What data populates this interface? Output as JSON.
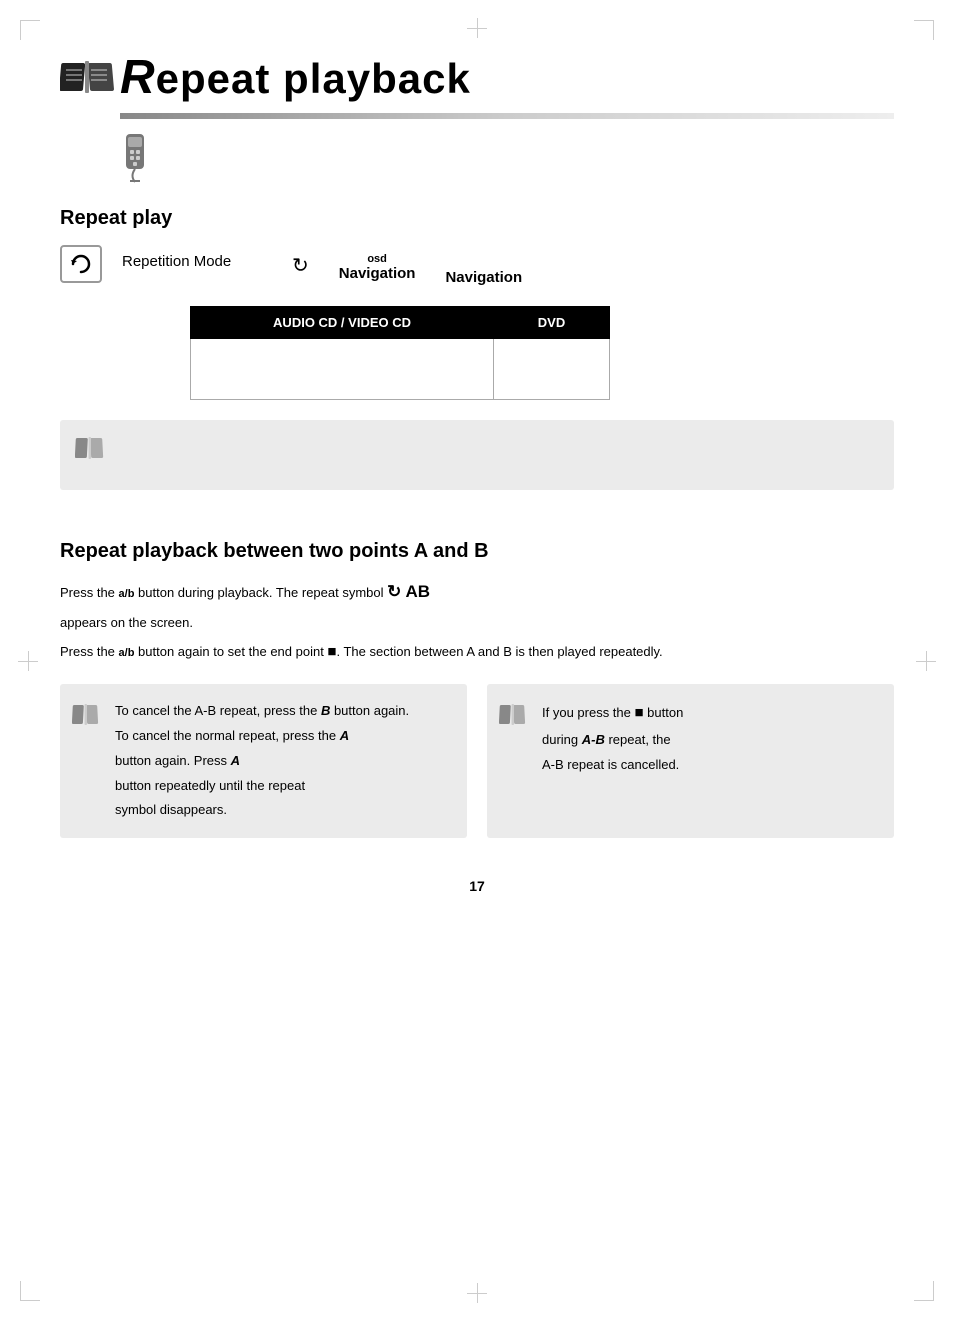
{
  "page": {
    "number": "17"
  },
  "title": {
    "main": "epeat playback",
    "R_prefix": "R"
  },
  "repeat_play": {
    "heading": "Repeat play",
    "button_symbol": "↻",
    "repetition_mode_label": "Repetition Mode",
    "repeat_symbol": "↻",
    "osd_label": "osd",
    "navigation_label": "Navigation",
    "navigation_label2": "Navigation",
    "table": {
      "col1_header": "AUDIO CD / VIDEO CD",
      "col2_header": "DVD",
      "col1_content": "",
      "col2_content": ""
    }
  },
  "ab_section": {
    "heading": "Repeat playback between two points A and B",
    "desc_line1_prefix": "Press the",
    "key_ab": "a/b",
    "desc_line1_suffix": "button during playback. The repeat symbol",
    "ab_symbol": "↻ AB",
    "desc_line2": "appears on the screen.",
    "desc_line3_prefix": "Press the",
    "key_ab2": "a/b",
    "desc_line3_middle": "button again to set the end point",
    "stop_symbol": "■",
    "desc_line3_suffix": ". The section between A and B is then played repeatedly.",
    "note_left": {
      "bold_B": "B",
      "text1_prefix": "To cancel the A-B repeat, press the",
      "bold_A1": "A",
      "text1_suffix": "button again.",
      "text2_prefix": "To cancel the normal repeat, press the",
      "bold_A2": "A",
      "text2_suffix": "button repeatedly until the repeat symbol disappears."
    },
    "note_right": {
      "stop_symbol": "■",
      "bold_AB": "A-B",
      "text": "If you press the stop button during A-B repeat, the A-B repeat is cancelled."
    }
  },
  "icons": {
    "book_open": "📖",
    "remote_symbol": "🔧"
  }
}
